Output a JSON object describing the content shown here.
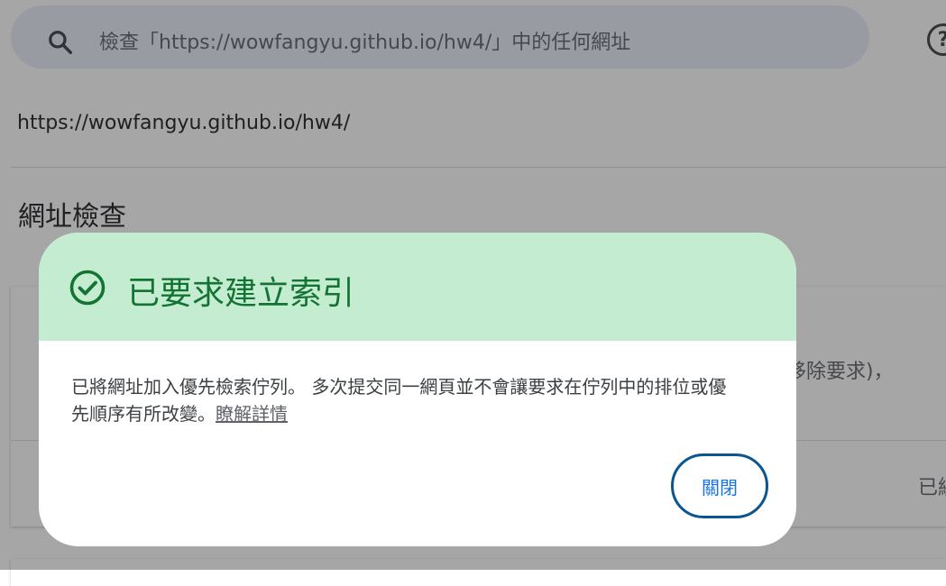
{
  "search": {
    "placeholder": "檢查「https://wowfangyu.github.io/hw4/」中的任何網址",
    "search_icon": "search-icon",
    "help_icon": "help-circle-icon",
    "help_glyph": "?"
  },
  "page": {
    "url": "https://wowfangyu.github.io/hw4/",
    "section_title": "網址檢查",
    "behind_text_1": "移除要求)，",
    "behind_text_2": "已經"
  },
  "dialog": {
    "icon": "check-circle-icon",
    "title": "已要求建立索引",
    "body_line1": "已將網址加入優先檢索佇列。 多次提交同一網頁並不會讓要求在佇列中的排位或優",
    "body_line2": "先順序有所改變。",
    "learn_more": "瞭解詳情",
    "close_label": "關閉"
  },
  "colors": {
    "header_bg": "#c4ecd0",
    "title_green": "#137333",
    "button_border": "#0b5590",
    "button_text": "#1a73e8",
    "search_bg": "#e9edf7"
  }
}
